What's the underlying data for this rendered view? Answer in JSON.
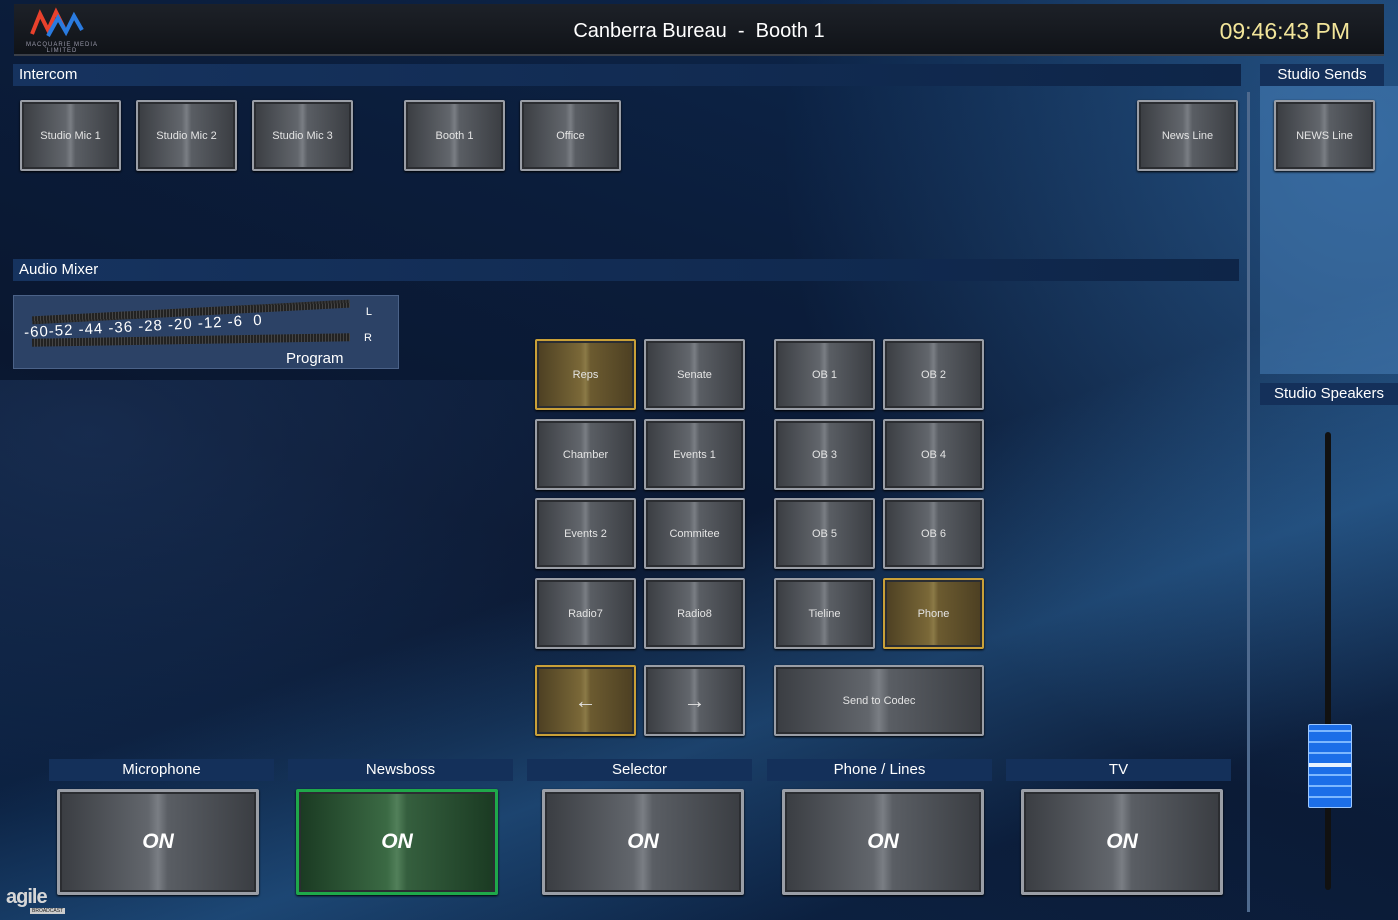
{
  "header": {
    "title": "Canberra Bureau  -  Booth 1",
    "clock": "09:46:43 PM",
    "logo_text": "MACQUARIE MEDIA LIMITED"
  },
  "sections": {
    "intercom": "Intercom",
    "studio_sends": "Studio Sends",
    "audio_mixer": "Audio Mixer",
    "studio_speakers": "Studio Speakers"
  },
  "intercom_buttons": [
    "Studio Mic 1",
    "Studio Mic 2",
    "Studio Mic 3",
    "Booth 1",
    "Office",
    "News Line"
  ],
  "studio_sends_buttons": [
    "NEWS Line"
  ],
  "meter": {
    "scale": "-60-52 -44 -36 -28 -20 -12 -6  0",
    "left_label": "L",
    "right_label": "R",
    "label": "Program"
  },
  "source_grid_left": [
    "Reps",
    "Senate",
    "Chamber",
    "Events 1",
    "Events 2",
    "Commitee",
    "Radio7",
    "Radio8"
  ],
  "source_grid_right": [
    "OB 1",
    "OB 2",
    "OB 3",
    "OB 4",
    "OB 5",
    "OB 6",
    "Tieline",
    "Phone"
  ],
  "nav": {
    "prev": "←",
    "next": "→",
    "send": "Send to Codec"
  },
  "channels": [
    {
      "name": "Microphone",
      "state": "ON"
    },
    {
      "name": "Newsboss",
      "state": "ON"
    },
    {
      "name": "Selector",
      "state": "ON"
    },
    {
      "name": "Phone / Lines",
      "state": "ON"
    },
    {
      "name": "TV",
      "state": "ON"
    }
  ],
  "studio_speakers_level": 0.22,
  "footer_brand": "agile",
  "footer_brand_sub": "BROADCAST",
  "colors": {
    "gold_border": "#c9a038",
    "green_border": "#1fa84a",
    "clock": "#f2e59a",
    "fader": "#1c6ee8"
  }
}
